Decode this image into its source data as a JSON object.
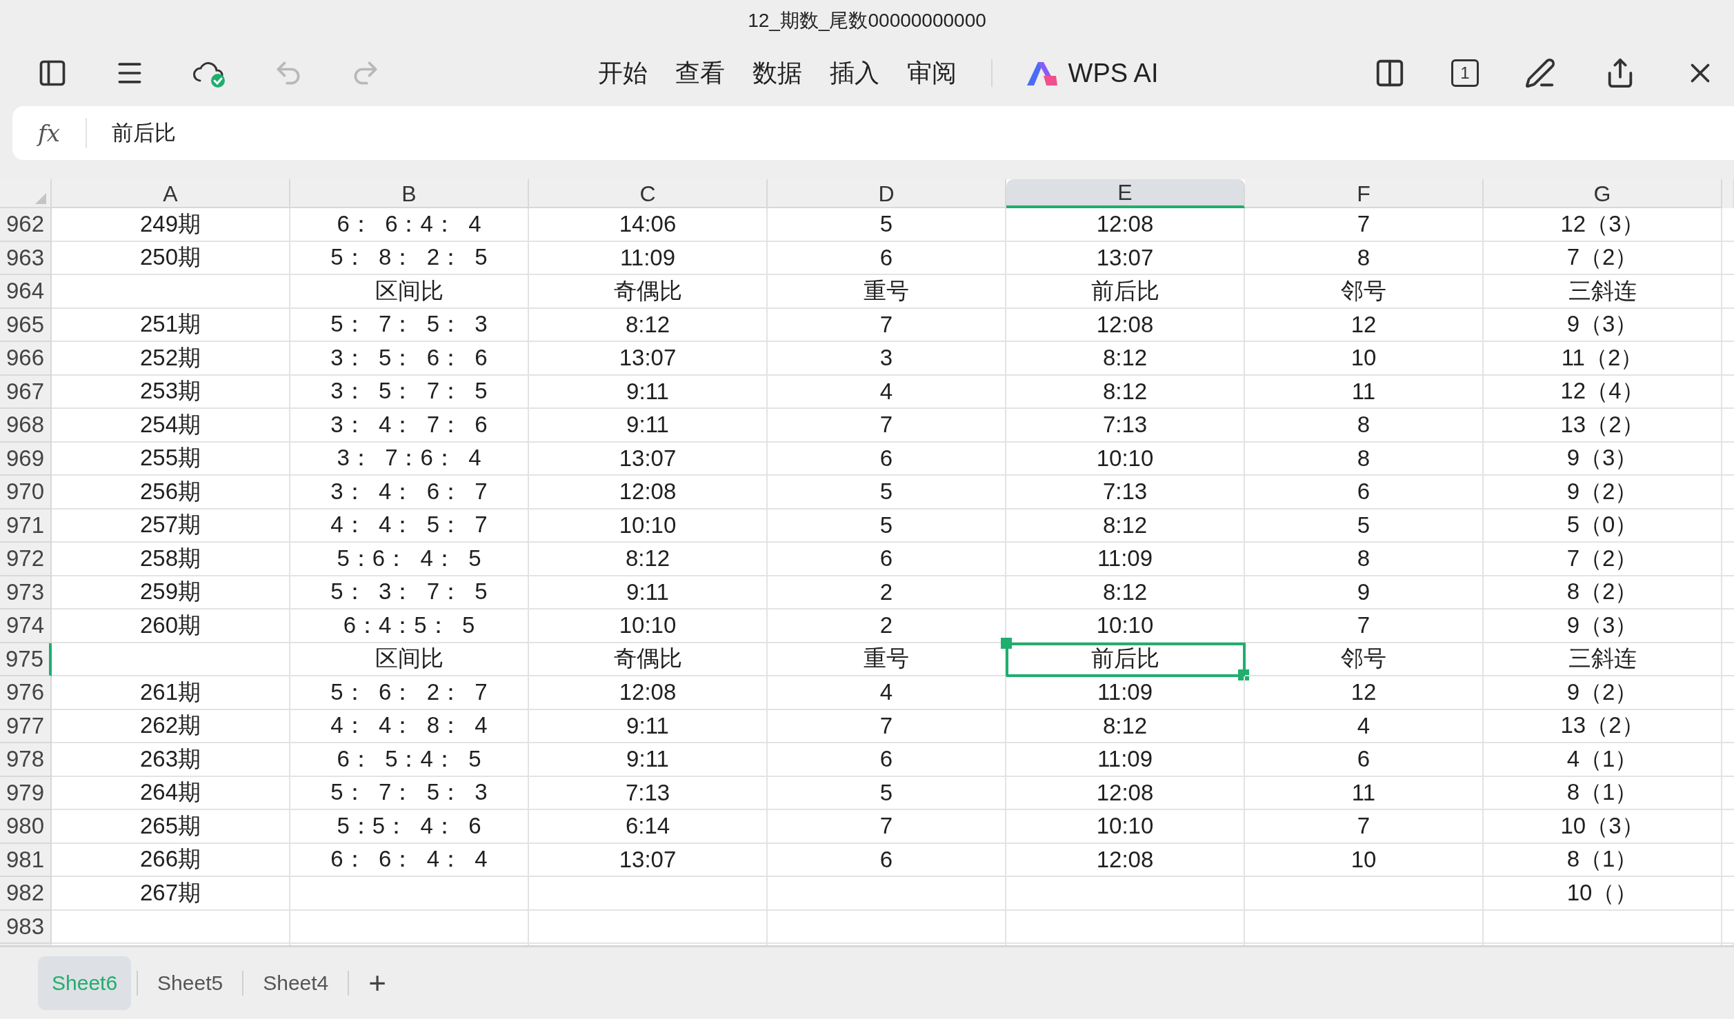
{
  "window": {
    "title": "12_期数_尾数00000000000"
  },
  "toolbar": {
    "menus": [
      {
        "label": "开始"
      },
      {
        "label": "查看"
      },
      {
        "label": "数据"
      },
      {
        "label": "插入"
      },
      {
        "label": "审阅"
      }
    ],
    "ai_label": "WPS AI",
    "page_count": "1",
    "undo_disabled": true,
    "redo_disabled": true
  },
  "formula_bar": {
    "fx": "fx",
    "value": "前后比"
  },
  "columns": [
    {
      "label": "A",
      "selected": false
    },
    {
      "label": "B",
      "selected": false
    },
    {
      "label": "C",
      "selected": false
    },
    {
      "label": "D",
      "selected": false
    },
    {
      "label": "E",
      "selected": true
    },
    {
      "label": "F",
      "selected": false
    },
    {
      "label": "G",
      "selected": false
    }
  ],
  "rows": [
    {
      "number": "962",
      "selected": false,
      "cells": [
        "249期",
        "6：  6：4：  4",
        "14:06",
        "5",
        "12:08",
        "7",
        "12（3）"
      ]
    },
    {
      "number": "963",
      "selected": false,
      "cells": [
        "250期",
        "5：  8：  2：  5",
        "11:09",
        "6",
        "13:07",
        "8",
        "7（2）"
      ]
    },
    {
      "number": "964",
      "selected": false,
      "cells": [
        "",
        "区间比",
        "奇偶比",
        "重号",
        "前后比",
        "邻号",
        "三斜连"
      ]
    },
    {
      "number": "965",
      "selected": false,
      "cells": [
        "251期",
        "5：  7：  5：  3",
        "8:12",
        "7",
        "12:08",
        "12",
        "9（3）"
      ]
    },
    {
      "number": "966",
      "selected": false,
      "cells": [
        "252期",
        "3：  5：  6：  6",
        "13:07",
        "3",
        "8:12",
        "10",
        "11（2）"
      ]
    },
    {
      "number": "967",
      "selected": false,
      "cells": [
        "253期",
        "3：  5：  7：  5",
        "9:11",
        "4",
        "8:12",
        "11",
        "12（4）"
      ]
    },
    {
      "number": "968",
      "selected": false,
      "cells": [
        "254期",
        "3：  4：  7：  6",
        "9:11",
        "7",
        "7:13",
        "8",
        "13（2）"
      ]
    },
    {
      "number": "969",
      "selected": false,
      "cells": [
        "255期",
        "3：  7：6：  4",
        "13:07",
        "6",
        "10:10",
        "8",
        "9（3）"
      ]
    },
    {
      "number": "970",
      "selected": false,
      "cells": [
        "256期",
        "3：  4：  6：  7",
        "12:08",
        "5",
        "7:13",
        "6",
        "9（2）"
      ]
    },
    {
      "number": "971",
      "selected": false,
      "cells": [
        "257期",
        "4：  4：  5：  7",
        "10:10",
        "5",
        "8:12",
        "5",
        "5（0）"
      ]
    },
    {
      "number": "972",
      "selected": false,
      "cells": [
        "258期",
        "5：6：  4：  5",
        "8:12",
        "6",
        "11:09",
        "8",
        "7（2）"
      ]
    },
    {
      "number": "973",
      "selected": false,
      "cells": [
        "259期",
        "5：  3：  7：  5",
        "9:11",
        "2",
        "8:12",
        "9",
        "8（2）"
      ]
    },
    {
      "number": "974",
      "selected": false,
      "cells": [
        "260期",
        "6：4：5：  5",
        "10:10",
        "2",
        "10:10",
        "7",
        "9（3）"
      ]
    },
    {
      "number": "975",
      "selected": true,
      "cells": [
        "",
        "区间比",
        "奇偶比",
        "重号",
        "前后比",
        "邻号",
        "三斜连"
      ]
    },
    {
      "number": "976",
      "selected": false,
      "cells": [
        "261期",
        "5：  6：  2：  7",
        "12:08",
        "4",
        "11:09",
        "12",
        "9（2）"
      ]
    },
    {
      "number": "977",
      "selected": false,
      "cells": [
        "262期",
        "4：  4：  8：  4",
        "9:11",
        "7",
        "8:12",
        "4",
        "13（2）"
      ]
    },
    {
      "number": "978",
      "selected": false,
      "cells": [
        "263期",
        "6：  5：4：  5",
        "9:11",
        "6",
        "11:09",
        "6",
        "4（1）"
      ]
    },
    {
      "number": "979",
      "selected": false,
      "cells": [
        "264期",
        "5：  7：  5：  3",
        "7:13",
        "5",
        "12:08",
        "11",
        "8（1）"
      ]
    },
    {
      "number": "980",
      "selected": false,
      "cells": [
        "265期",
        "5：5：  4：  6",
        "6:14",
        "7",
        "10:10",
        "7",
        "10（3）"
      ]
    },
    {
      "number": "981",
      "selected": false,
      "cells": [
        "266期",
        "6：  6：  4：  4",
        "13:07",
        "6",
        "12:08",
        "10",
        "8（1）"
      ]
    },
    {
      "number": "982",
      "selected": false,
      "cells": [
        "267期",
        "",
        "",
        "",
        "",
        "",
        "10（）"
      ]
    },
    {
      "number": "983",
      "selected": false,
      "cells": [
        "",
        "",
        "",
        "",
        "",
        "",
        ""
      ]
    }
  ],
  "sheet_tabs": [
    {
      "label": "Sheet6",
      "selected": true
    },
    {
      "label": "Sheet5",
      "selected": false
    },
    {
      "label": "Sheet4",
      "selected": false
    }
  ],
  "add_sheet": "+"
}
